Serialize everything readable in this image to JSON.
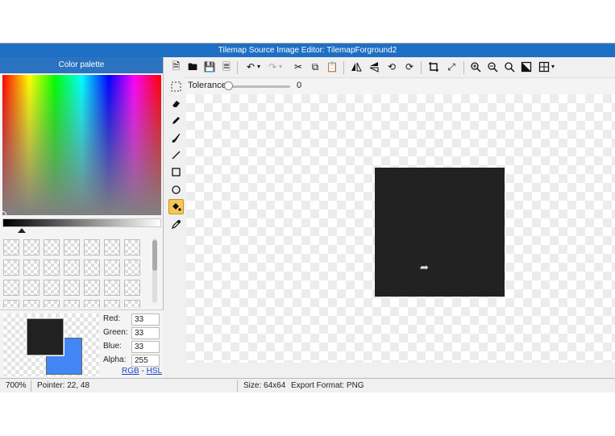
{
  "window": {
    "title": "Tilemap Source Image Editor: TilemapForground2"
  },
  "palette": {
    "title": "Color palette"
  },
  "color": {
    "foreground": "#212121",
    "background": "#4285f4",
    "red_label": "Red:",
    "red": "33",
    "green_label": "Green:",
    "green": "33",
    "blue_label": "Blue:",
    "blue": "33",
    "alpha_label": "Alpha:",
    "alpha": "255",
    "format_rgb": "RGB",
    "format_sep": " - ",
    "format_hsl": "HSL"
  },
  "options": {
    "tolerance_label": "Tolerance",
    "tolerance_value": "0",
    "tolerance_fraction": 0
  },
  "tools": [
    "select-rect",
    "eraser",
    "pencil",
    "brush",
    "line",
    "rectangle",
    "ellipse",
    "fill",
    "eyedropper"
  ],
  "active_tool": "fill",
  "toolbar_icons": [
    "new-file",
    "open-folder",
    "save",
    "export",
    "undo",
    "redo",
    "cut",
    "copy",
    "paste",
    "flip-horizontal",
    "flip-vertical",
    "rotate-left",
    "rotate-right",
    "crop",
    "resize",
    "zoom-in",
    "zoom-out",
    "zoom-fit",
    "invert",
    "grid"
  ],
  "status": {
    "zoom": "700%",
    "pointer": "Pointer: 22, 48",
    "size": "Size: 64x64",
    "export": "Export Format: PNG"
  }
}
